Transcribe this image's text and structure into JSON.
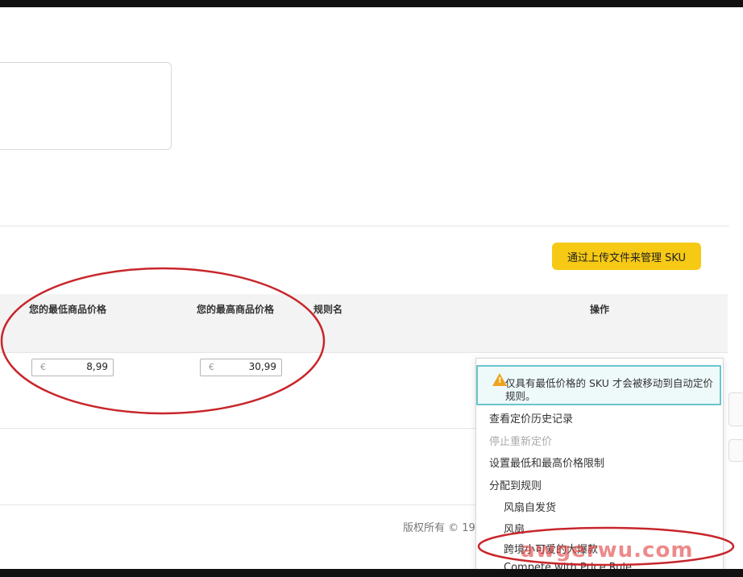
{
  "upload_button_label": "通过上传文件来管理 SKU",
  "table": {
    "headers": {
      "min_price": "您的最低商品价格",
      "max_price": "您的最高商品价格",
      "rule_name": "规则名",
      "actions": "操作"
    },
    "row": {
      "currency": "€",
      "min_price": "8,99",
      "max_price": "30,99"
    }
  },
  "footer_text": "版权所有 © 19",
  "actions_menu": {
    "notice": "仅具有最低价格的 SKU 才会被移动到自动定价规则。",
    "items": [
      {
        "label": "查看定价历史记录",
        "enabled": true
      },
      {
        "label": "停止重新定价",
        "enabled": false
      },
      {
        "label": "设置最低和最高价格限制",
        "enabled": true
      },
      {
        "label": "分配到规则",
        "enabled": true
      }
    ],
    "rules": [
      "风扇自发货",
      "风扇",
      "跨境小可爱的大爆款"
    ],
    "cut_item": "Compete with Price Rule"
  },
  "watermark": "awgerwu.com",
  "colors": {
    "accent_yellow": "#f6c915",
    "annotation_red": "#c8262b",
    "notice_border": "#69c5cc"
  }
}
